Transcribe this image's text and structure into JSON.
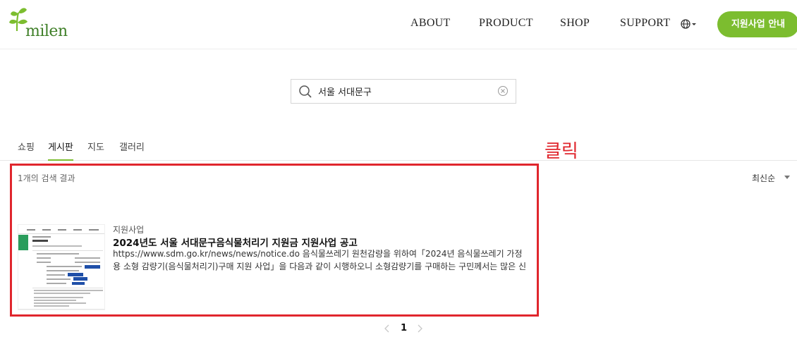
{
  "header": {
    "logo_text": "milen",
    "nav": [
      "ABOUT",
      "PRODUCT",
      "SHOP",
      "SUPPORT"
    ],
    "language_icon": "globe-icon",
    "cta_label": "지원사업 안내"
  },
  "search": {
    "value": "서울 서대문구",
    "placeholder": "",
    "search_icon": "search-icon",
    "clear_icon": "clear-icon"
  },
  "tabs": [
    {
      "label": "쇼핑",
      "active": false
    },
    {
      "label": "게시판",
      "active": true
    },
    {
      "label": "지도",
      "active": false
    },
    {
      "label": "갤러리",
      "active": false
    }
  ],
  "annotation": {
    "label": "클릭",
    "color": "#e0262d"
  },
  "results": {
    "count_text": "1개의 검색 결과",
    "sort_label": "최신순",
    "items": [
      {
        "category": "지원사업",
        "title": "2024년도 서울 서대문구음식물처리기 지원금 지원사업 공고",
        "snippet": "https://www.sdm.go.kr/news/news/notice.do 음식물쓰레기 원천감량을 위하여「2024년 음식물쓰레기 가정용 소형 감량기(음식물처리기)구매 지원 사업」을 다음과 같이 시행하오니 소형감량기를 구매하는 구민께서는 많은 신청 바랍니다. …"
      }
    ]
  },
  "pagination": {
    "prev_icon": "chevron-left-icon",
    "current": "1",
    "next_icon": "chevron-right-icon"
  },
  "colors": {
    "brand_green": "#7cbd2f",
    "logo_green": "#3f7f28",
    "annotation_red": "#e0262d"
  }
}
